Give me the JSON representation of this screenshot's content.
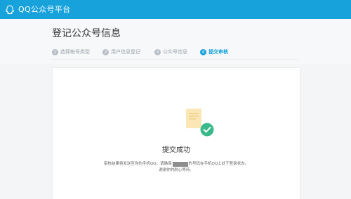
{
  "topbar": {
    "brand": "QQ公众号平台",
    "logo_icon": "qq-logo-icon",
    "color": "#17a2dc"
  },
  "header": {
    "title": "登记公众号信息"
  },
  "steps": [
    {
      "num": "1",
      "label": "选择帐号类型"
    },
    {
      "num": "2",
      "label": "用户信息登记"
    },
    {
      "num": "3",
      "label": "公众号信息"
    },
    {
      "num": "4",
      "label": "提交审核",
      "active": true
    }
  ],
  "result": {
    "title": "提交成功",
    "desc_part1": "审核结果将发送至你的手机QQ，请确保",
    "desc_part2": "的号码在手机QQ上处于登录状态。",
    "desc_line2": "谢谢你的耐心等待。",
    "doc_icon": "document-icon",
    "check_icon": "check-circle-icon",
    "success_color": "#3ab98a"
  }
}
